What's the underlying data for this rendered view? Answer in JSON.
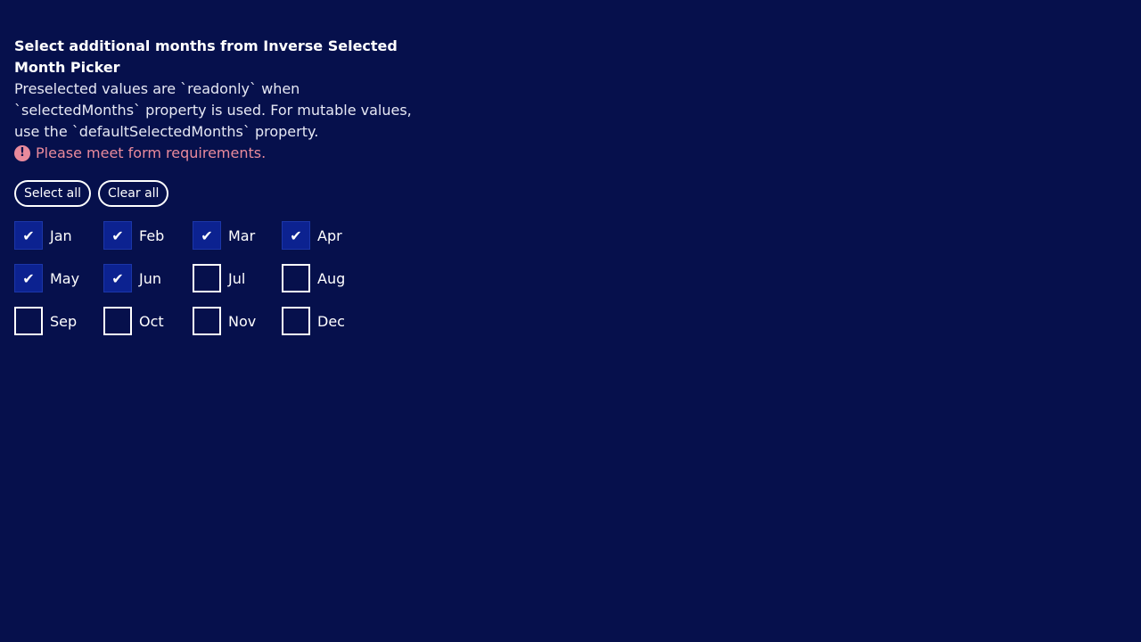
{
  "title": "Select additional months from Inverse Selected Month Picker",
  "description": "Preselected values are `readonly` when `selectedMonths` property is used. For mutable values, use the `defaultSelectedMonths` property.",
  "error": "Please meet form requirements.",
  "buttons": {
    "select_all": "Select all",
    "clear_all": "Clear all"
  },
  "months": [
    {
      "label": "Jan",
      "checked": true
    },
    {
      "label": "Feb",
      "checked": true
    },
    {
      "label": "Mar",
      "checked": true
    },
    {
      "label": "Apr",
      "checked": true
    },
    {
      "label": "May",
      "checked": true
    },
    {
      "label": "Jun",
      "checked": true
    },
    {
      "label": "Jul",
      "checked": false
    },
    {
      "label": "Aug",
      "checked": false
    },
    {
      "label": "Sep",
      "checked": false
    },
    {
      "label": "Oct",
      "checked": false
    },
    {
      "label": "Nov",
      "checked": false
    },
    {
      "label": "Dec",
      "checked": false
    }
  ]
}
